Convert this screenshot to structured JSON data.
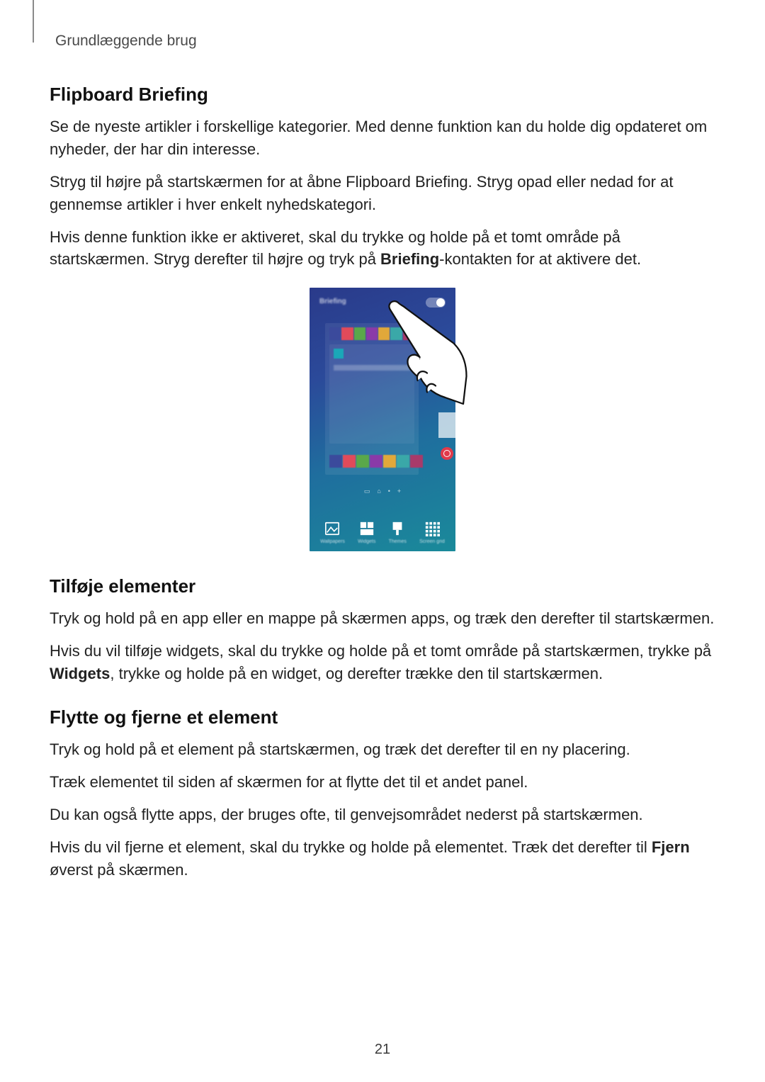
{
  "header": {
    "breadcrumb": "Grundlæggende brug"
  },
  "section_flipboard": {
    "heading": "Flipboard Briefing",
    "p1": "Se de nyeste artikler i forskellige kategorier. Med denne funktion kan du holde dig opdateret om nyheder, der har din interesse.",
    "p2": "Stryg til højre på startskærmen for at åbne Flipboard Briefing. Stryg opad eller nedad for at gennemse artikler i hver enkelt nyhedskategori.",
    "p3_a": "Hvis denne funktion ikke er aktiveret, skal du trykke og holde på et tomt område på startskærmen. Stryg derefter til højre og tryk på ",
    "p3_bold": "Briefing",
    "p3_b": "-kontakten for at aktivere det."
  },
  "figure": {
    "top_label": "Briefing",
    "bottom_items": [
      "Wallpapers",
      "Widgets",
      "Themes",
      "Screen grid"
    ]
  },
  "section_add": {
    "heading": "Tilføje elementer",
    "p1": "Tryk og hold på en app eller en mappe på skærmen apps, og træk den derefter til startskærmen.",
    "p2_a": "Hvis du vil tilføje widgets, skal du trykke og holde på et tomt område på startskærmen, trykke på ",
    "p2_bold": "Widgets",
    "p2_b": ", trykke og holde på en widget, og derefter trække den til startskærmen."
  },
  "section_move": {
    "heading": "Flytte og fjerne et element",
    "p1": "Tryk og hold på et element på startskærmen, og træk det derefter til en ny placering.",
    "p2": "Træk elementet til siden af skærmen for at flytte det til et andet panel.",
    "p3": "Du kan også flytte apps, der bruges ofte, til genvejsområdet nederst på startskærmen.",
    "p4_a": "Hvis du vil fjerne et element, skal du trykke og holde på elementet. Træk det derefter til ",
    "p4_bold": "Fjern",
    "p4_b": " øverst på skærmen."
  },
  "page_number": "21"
}
